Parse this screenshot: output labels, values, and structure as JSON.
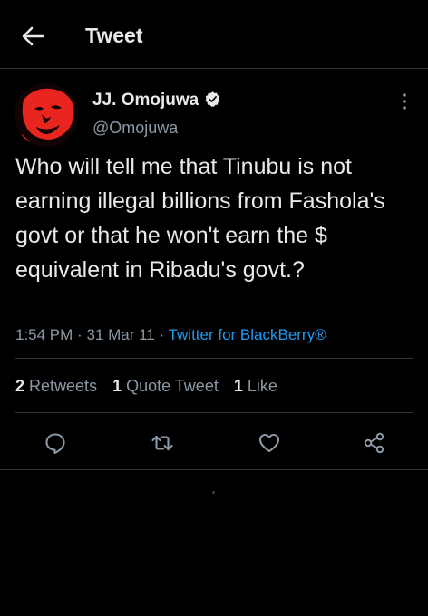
{
  "header": {
    "title": "Tweet",
    "back_icon": "arrow-left-icon"
  },
  "author": {
    "name": "JJ. Omojuwa",
    "handle": "@Omojuwa",
    "verified": true,
    "avatar_colors": [
      "#e8251f",
      "#120404"
    ]
  },
  "tweet": {
    "text": "Who will tell me that Tinubu is not earning illegal billions from Fashola's govt or that he won't earn the $ equivalent in Ribadu's govt.?",
    "time": "1:54 PM",
    "separator": "·",
    "date": "31 Mar 11",
    "source": "Twitter for BlackBerry®"
  },
  "stats": {
    "retweets": {
      "count": "2",
      "label": "Retweets"
    },
    "quotes": {
      "count": "1",
      "label": "Quote Tweet"
    },
    "likes": {
      "count": "1",
      "label": "Like"
    }
  },
  "actions": [
    "reply-icon",
    "retweet-icon",
    "like-icon",
    "share-icon"
  ],
  "colors": {
    "background": "#000000",
    "text": "#e7e9ea",
    "secondary": "#8b98a5",
    "accent": "#1d9bf0",
    "divider": "#2f3336"
  }
}
